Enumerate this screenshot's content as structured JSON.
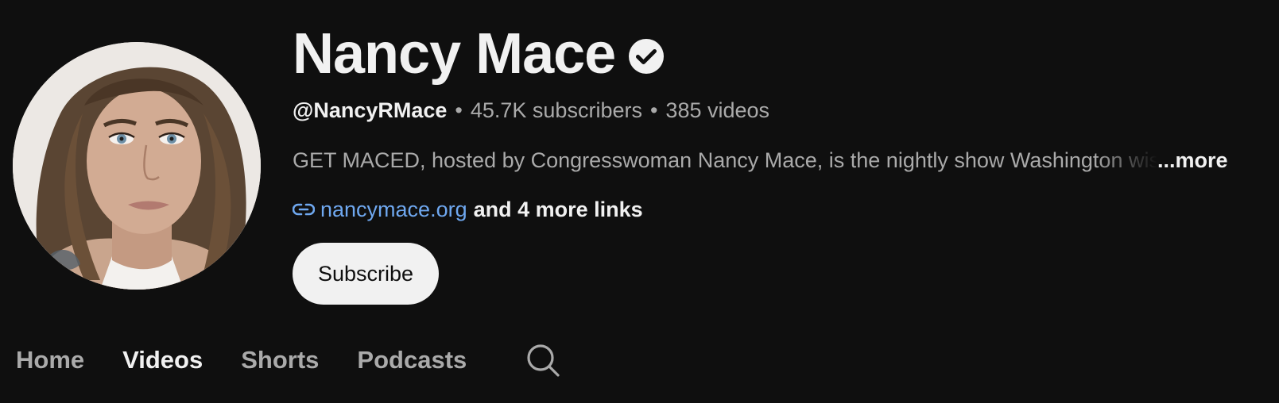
{
  "channel": {
    "name": "Nancy Mace",
    "handle": "@NancyRMace",
    "subscribers": "45.7K subscribers",
    "videos": "385 videos",
    "separator": "•",
    "description": "GET MACED, hosted by Congresswoman Nancy Mace, is the nightly show Washington wishes you wouldn't watch.",
    "description_more": "...more",
    "link_text": "nancymace.org",
    "more_links": "and 4 more links"
  },
  "actions": {
    "subscribe_label": "Subscribe"
  },
  "tabs": [
    {
      "label": "Home",
      "active": false
    },
    {
      "label": "Videos",
      "active": true
    },
    {
      "label": "Shorts",
      "active": false
    },
    {
      "label": "Podcasts",
      "active": false
    }
  ],
  "icons": {
    "verified": "verified-check-icon",
    "link": "link-icon",
    "search": "search-icon"
  },
  "colors": {
    "background": "#0f0f0f",
    "text_primary": "#f1f1f1",
    "text_secondary": "#aaaaaa",
    "link": "#6fa8f0",
    "button_bg": "#f1f1f1"
  }
}
